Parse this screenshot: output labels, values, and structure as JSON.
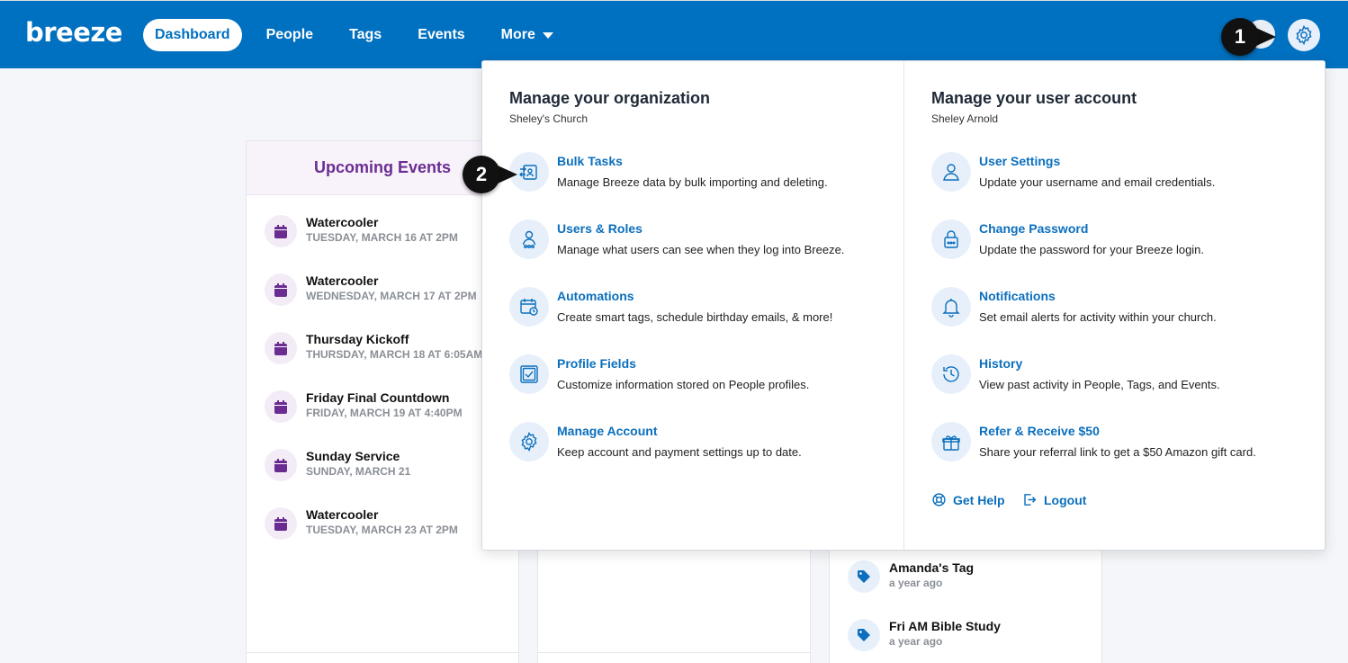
{
  "app": {
    "logo": "breeze"
  },
  "nav": {
    "items": [
      {
        "label": "Dashboard",
        "active": true
      },
      {
        "label": "People",
        "active": false
      },
      {
        "label": "Tags",
        "active": false
      },
      {
        "label": "Events",
        "active": false
      },
      {
        "label": "More",
        "active": false
      }
    ]
  },
  "markers": {
    "one": "1",
    "two": "2"
  },
  "events": {
    "title": "Upcoming Events",
    "items": [
      {
        "name": "Watercooler",
        "date": "TUESDAY, MARCH 16 AT 2PM"
      },
      {
        "name": "Watercooler",
        "date": "WEDNESDAY, MARCH 17 AT 2PM"
      },
      {
        "name": "Thursday Kickoff",
        "date": "THURSDAY, MARCH 18 AT 6:05AM"
      },
      {
        "name": "Friday Final Countdown",
        "date": "FRIDAY, MARCH 19 AT 4:40PM"
      },
      {
        "name": "Sunday Service",
        "date": "SUNDAY, MARCH 21"
      },
      {
        "name": "Watercooler",
        "date": "TUESDAY, MARCH 23 AT 2PM"
      }
    ]
  },
  "tags": {
    "items": [
      {
        "name": "Amanda's Tag",
        "time": "a year ago"
      },
      {
        "name": "Fri AM Bible Study",
        "time": "a year ago"
      }
    ]
  },
  "dropdown": {
    "org": {
      "title": "Manage your organization",
      "subtitle": "Sheley's Church",
      "items": [
        {
          "label": "Bulk Tasks",
          "desc": "Manage Breeze data by bulk importing and deleting.",
          "icon": "bulk-import-icon"
        },
        {
          "label": "Users & Roles",
          "desc": "Manage what users can see when they log into Breeze.",
          "icon": "user-roles-icon"
        },
        {
          "label": "Automations",
          "desc": "Create smart tags, schedule birthday emails, & more!",
          "icon": "calendar-clock-icon"
        },
        {
          "label": "Profile Fields",
          "desc": "Customize information stored on People profiles.",
          "icon": "checkbox-icon"
        },
        {
          "label": "Manage Account",
          "desc": "Keep account and payment settings up to date.",
          "icon": "gear-icon"
        }
      ]
    },
    "user": {
      "title": "Manage your user account",
      "subtitle": "Sheley Arnold",
      "items": [
        {
          "label": "User Settings",
          "desc": "Update your username and email credentials.",
          "icon": "user-icon"
        },
        {
          "label": "Change Password",
          "desc": "Update the password for your Breeze login.",
          "icon": "lock-icon"
        },
        {
          "label": "Notifications",
          "desc": "Set email alerts for activity within your church.",
          "icon": "bell-icon"
        },
        {
          "label": "History",
          "desc": "View past activity in People, Tags, and Events.",
          "icon": "history-icon"
        },
        {
          "label": "Refer & Receive $50",
          "desc": "Share your referral link to get a $50 Amazon gift card.",
          "icon": "gift-icon"
        }
      ]
    },
    "footer": {
      "help": "Get Help",
      "logout": "Logout"
    }
  },
  "colors": {
    "brand": "#0070c0",
    "link": "#0b6fbd",
    "events_accent": "#6b2c91"
  }
}
